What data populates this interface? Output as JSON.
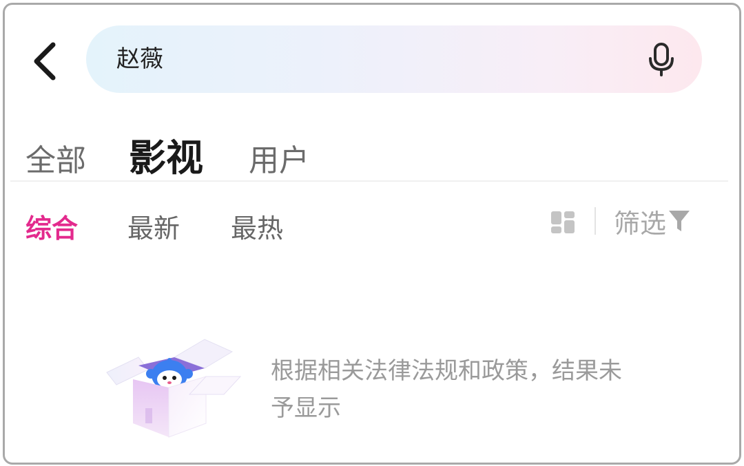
{
  "search": {
    "query": "赵薇"
  },
  "top_tabs": [
    {
      "label": "全部",
      "active": false
    },
    {
      "label": "影视",
      "active": true
    },
    {
      "label": "用户",
      "active": false
    }
  ],
  "sub_tabs": [
    {
      "label": "综合",
      "active": true
    },
    {
      "label": "最新",
      "active": false
    },
    {
      "label": "最热",
      "active": false
    }
  ],
  "filter": {
    "label": "筛选"
  },
  "empty_state": {
    "message": "根据相关法律法规和政策，结果未予显示"
  },
  "colors": {
    "accent": "#e32a8d",
    "search_gradient_start": "#e4f3fb",
    "search_gradient_end": "#fde8ee"
  },
  "icons": {
    "back": "chevron-left-icon",
    "mic": "microphone-icon",
    "layout": "grid-layout-icon",
    "filter": "funnel-icon",
    "empty": "mascot-box-illustration"
  }
}
